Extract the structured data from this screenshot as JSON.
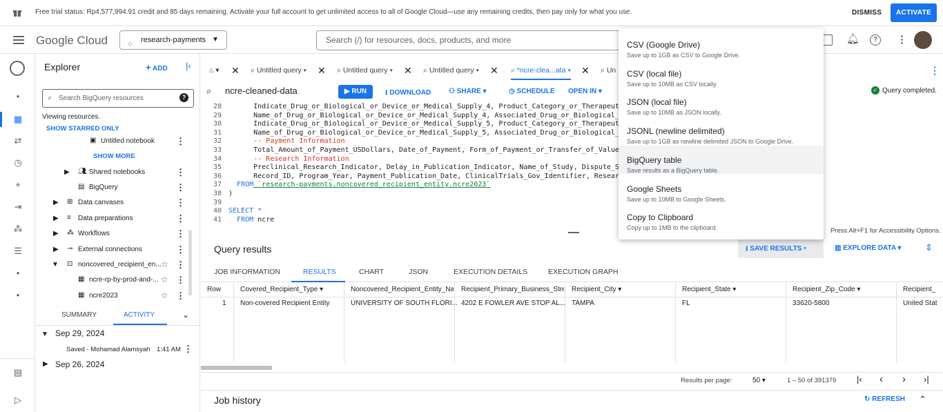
{
  "trial": {
    "message": "Free trial status: Rp4,577,994.91 credit and 85 days remaining. Activate your full account to get unlimited access to all of Google Cloud—use any remaining credits, then pay only for what you use.",
    "dismiss": "DISMISS",
    "activate": "ACTIVATE"
  },
  "header": {
    "logo": "Google Cloud",
    "project": "research-payments",
    "search_placeholder": "Search (/) for resources, docs, products, and more"
  },
  "explorer": {
    "title": "Explorer",
    "add": "ADD",
    "search_placeholder": "Search BigQuery resources",
    "viewing": "Viewing resources.",
    "show_starred": "SHOW STARRED ONLY",
    "untitled_notebook": "Untitled notebook",
    "show_more": "SHOW MORE",
    "items": [
      {
        "label": "Shared notebooks"
      },
      {
        "label": "BigQuery"
      },
      {
        "label": "Data canvases"
      },
      {
        "label": "Data preparations"
      },
      {
        "label": "Workflows"
      },
      {
        "label": "External connections"
      },
      {
        "label": "noncovered_recipient_en..."
      },
      {
        "label": "ncre-rp-by-prod-and-..."
      },
      {
        "label": "ncre2023"
      }
    ],
    "tab_summary": "SUMMARY",
    "tab_activity": "ACTIVITY",
    "date1": "Sep 29, 2024",
    "saved": "Saved - Mohamad Alamsyah",
    "saved_time": "1:41 AM",
    "date2": "Sep 26, 2024"
  },
  "tabs": [
    {
      "label": "Untitled query"
    },
    {
      "label": "Untitled query"
    },
    {
      "label": "Untitled query"
    },
    {
      "label": "*ncre-clea...ata"
    },
    {
      "label": "Un"
    }
  ],
  "toolbar": {
    "query_name": "ncre-cleaned-data",
    "run": "RUN",
    "download": "DOWNLOAD",
    "share": "SHARE",
    "schedule": "SCHEDULE",
    "open_in": "OPEN IN",
    "status": "Query completed."
  },
  "code": [
    {
      "n": "28",
      "text": "      Indicate_Drug_or_Biological_or_Device_or_Medical_Supply_4, Product_Category_or_Therapeuti",
      "cls": ""
    },
    {
      "n": "29",
      "text": "      Name_of_Drug_or_Biological_or_Device_or_Medical_Supply_4, Associated_Drug_or_Biological_M",
      "cls": ""
    },
    {
      "n": "30",
      "text": "      Indicate_Drug_or_Biological_or_Device_or_Medical_Supply_5, Product_Category_or_Therapeuti",
      "cls": ""
    },
    {
      "n": "31",
      "text": "      Name_of_Drug_or_Biological_or_Device_or_Medical_Supply_5, Associated_Drug_or_Biological_M",
      "cls": ""
    },
    {
      "n": "32",
      "text": "      -- Payment Information",
      "cls": "cmt"
    },
    {
      "n": "33",
      "text": "      Total_Amount_of_Payment_USDollars, Date_of_Payment, Form_of_Payment_or_Transfer_of_Value,",
      "cls": ""
    },
    {
      "n": "34",
      "text": "      -- Research Information",
      "cls": "cmt"
    },
    {
      "n": "35",
      "text": "      Preclinical_Research_Indicator, Delay_in_Publication_Indicator, Name_of_Study, Dispute_St",
      "cls": ""
    },
    {
      "n": "36",
      "text": "      Record_ID, Program_Year, Payment_Publication_Date, ClinicalTrials_Gov_Identifier, Researc",
      "cls": ""
    },
    {
      "n": "37",
      "text": "  FROM `research-payments.noncovered_recipient_entity.ncre2023`",
      "cls": "from"
    },
    {
      "n": "38",
      "text": ")",
      "cls": ""
    },
    {
      "n": "39",
      "text": "",
      "cls": ""
    },
    {
      "n": "40",
      "text": "SELECT *",
      "cls": "kw"
    },
    {
      "n": "41",
      "text": "  FROM ncre",
      "cls": "from2"
    }
  ],
  "menu": [
    {
      "title": "CSV (Google Drive)",
      "sub": "Save up to 1GB as CSV to Google Drive."
    },
    {
      "title": "CSV (local file)",
      "sub": "Save up to 10MB as CSV locally."
    },
    {
      "title": "JSON (local file)",
      "sub": "Save up to 10MB as JSON locally."
    },
    {
      "title": "JSONL (newline delimited)",
      "sub": "Save up to 1GB as newline delimited JSON to Google Drive."
    },
    {
      "title": "BigQuery table",
      "sub": "Save results as a BigQuery table."
    },
    {
      "title": "Google Sheets",
      "sub": "Save up to 10MB to Google Sheets."
    },
    {
      "title": "Copy to Clipboard",
      "sub": "Copy up to 1MB to the clipboard."
    }
  ],
  "accessibility": "Press Alt+F1 for Accessibility Options.",
  "results": {
    "title": "Query results",
    "save_results": "SAVE RESULTS",
    "explore_data": "EXPLORE DATA",
    "tabs": [
      "JOB INFORMATION",
      "RESULTS",
      "CHART",
      "JSON",
      "EXECUTION DETAILS",
      "EXECUTION GRAPH"
    ],
    "columns": [
      "Row",
      "Covered_Recipient_Type",
      "Noncovered_Recipient_Entity_Name",
      "Recipient_Primary_Business_Street",
      "Recipient_City",
      "Recipient_State",
      "Recipient_Zip_Code",
      "Recipient_"
    ],
    "row": [
      "1",
      "Non-covered Recipient Entity",
      "UNIVERSITY OF SOUTH FLORI...",
      "4202 E FOWLER AVE STOP AL...",
      "TAMPA",
      "FL",
      "33620-5800",
      "United Stat"
    ],
    "per_page_label": "Results per page:",
    "per_page": "50",
    "range": "1 – 50 of 391379"
  },
  "job_history": {
    "title": "Job history",
    "refresh": "REFRESH"
  }
}
